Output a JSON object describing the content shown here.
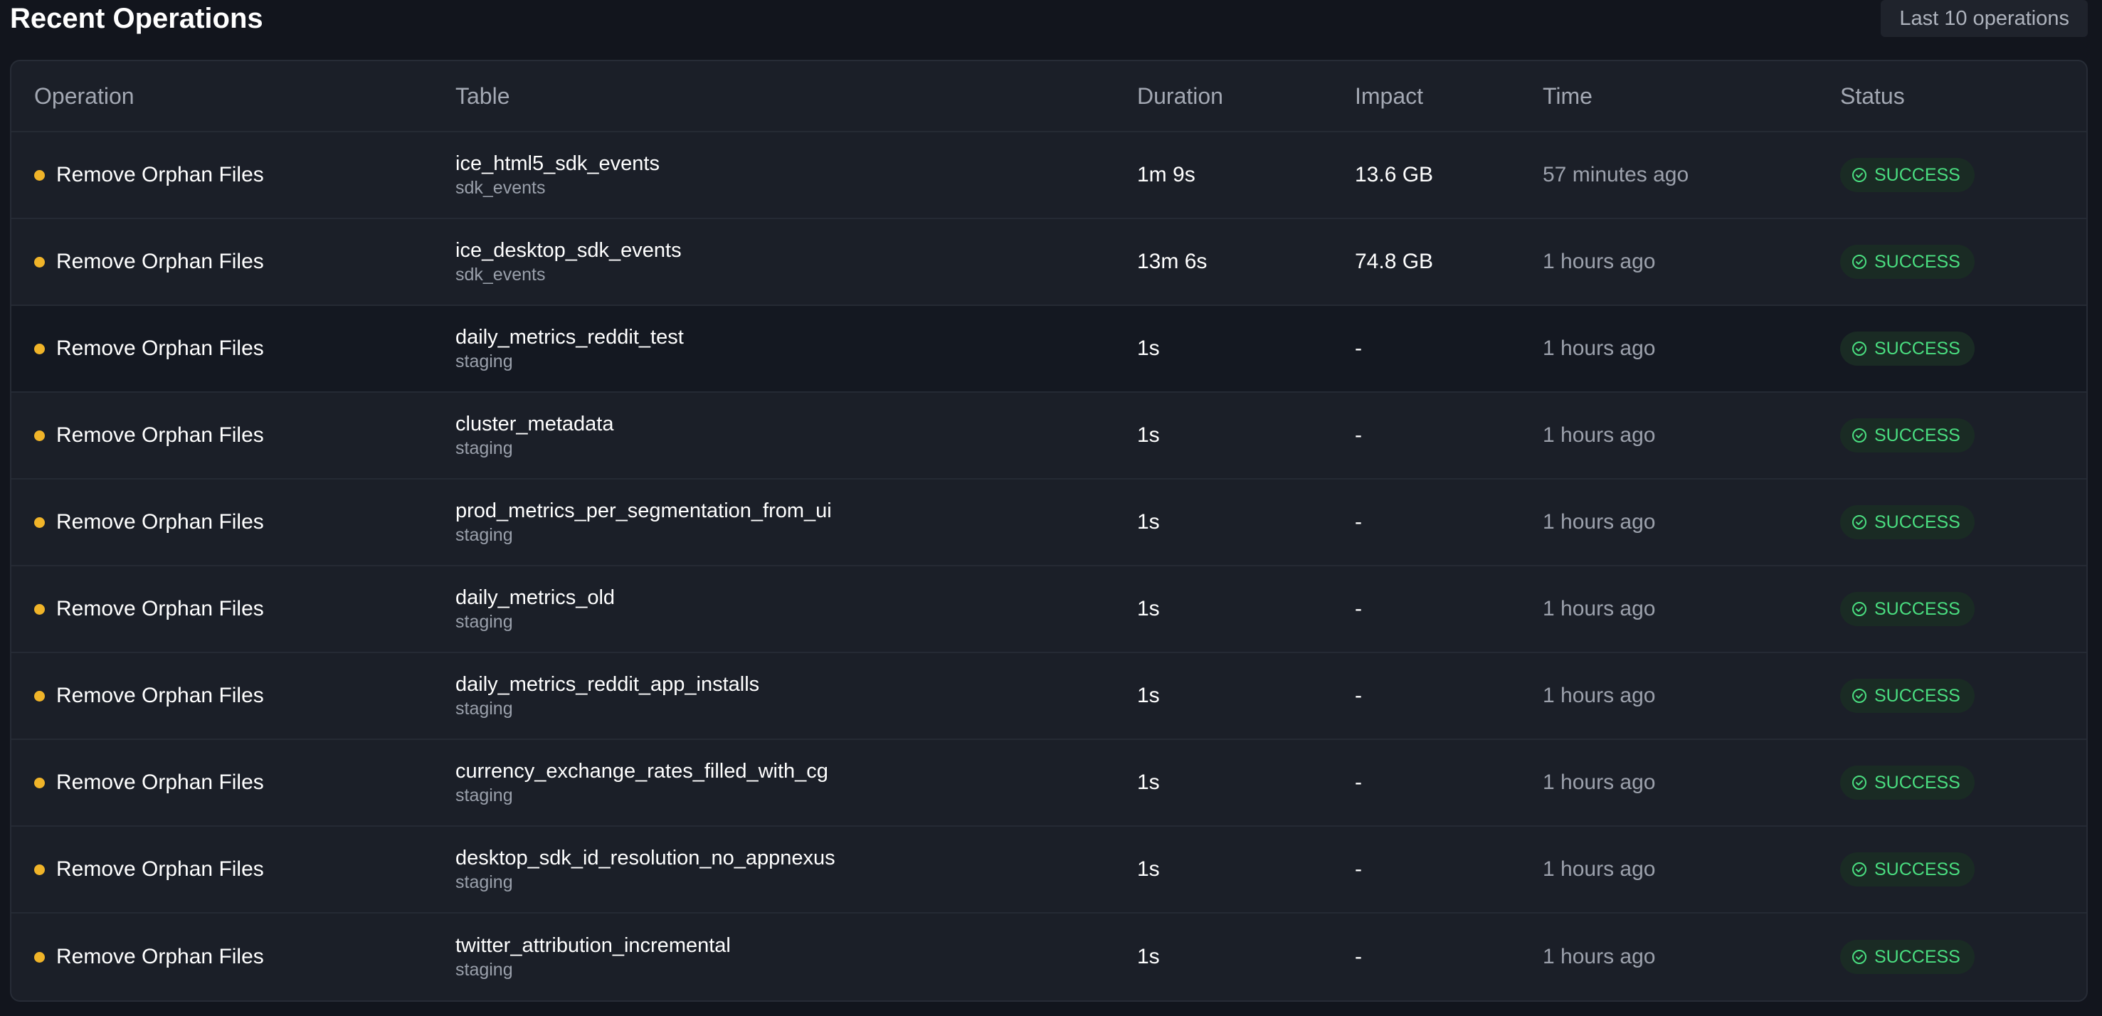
{
  "header": {
    "title": "Recent Operations",
    "count_label": "Last 10 operations"
  },
  "table": {
    "columns": [
      "Operation",
      "Table",
      "Duration",
      "Impact",
      "Time",
      "Status"
    ],
    "rows": [
      {
        "operation": "Remove Orphan Files",
        "table": "ice_html5_sdk_events",
        "schema": "sdk_events",
        "duration": "1m 9s",
        "impact": "13.6 GB",
        "time": "57 minutes ago",
        "status": "SUCCESS"
      },
      {
        "operation": "Remove Orphan Files",
        "table": "ice_desktop_sdk_events",
        "schema": "sdk_events",
        "duration": "13m 6s",
        "impact": "74.8 GB",
        "time": "1 hours ago",
        "status": "SUCCESS"
      },
      {
        "operation": "Remove Orphan Files",
        "table": "daily_metrics_reddit_test",
        "schema": "staging",
        "duration": "1s",
        "impact": "-",
        "time": "1 hours ago",
        "status": "SUCCESS"
      },
      {
        "operation": "Remove Orphan Files",
        "table": "cluster_metadata",
        "schema": "staging",
        "duration": "1s",
        "impact": "-",
        "time": "1 hours ago",
        "status": "SUCCESS"
      },
      {
        "operation": "Remove Orphan Files",
        "table": "prod_metrics_per_segmentation_from_ui",
        "schema": "staging",
        "duration": "1s",
        "impact": "-",
        "time": "1 hours ago",
        "status": "SUCCESS"
      },
      {
        "operation": "Remove Orphan Files",
        "table": "daily_metrics_old",
        "schema": "staging",
        "duration": "1s",
        "impact": "-",
        "time": "1 hours ago",
        "status": "SUCCESS"
      },
      {
        "operation": "Remove Orphan Files",
        "table": "daily_metrics_reddit_app_installs",
        "schema": "staging",
        "duration": "1s",
        "impact": "-",
        "time": "1 hours ago",
        "status": "SUCCESS"
      },
      {
        "operation": "Remove Orphan Files",
        "table": "currency_exchange_rates_filled_with_cg",
        "schema": "staging",
        "duration": "1s",
        "impact": "-",
        "time": "1 hours ago",
        "status": "SUCCESS"
      },
      {
        "operation": "Remove Orphan Files",
        "table": "desktop_sdk_id_resolution_no_appnexus",
        "schema": "staging",
        "duration": "1s",
        "impact": "-",
        "time": "1 hours ago",
        "status": "SUCCESS"
      },
      {
        "operation": "Remove Orphan Files",
        "table": "twitter_attribution_incremental",
        "schema": "staging",
        "duration": "1s",
        "impact": "-",
        "time": "1 hours ago",
        "status": "SUCCESS"
      }
    ]
  },
  "icons": {
    "operation_dot": "status-dot-icon",
    "status": "check-circle-icon"
  },
  "colors": {
    "background": "#12151d",
    "card": "#1b1f28",
    "operation_dot": "#f0b429",
    "success_text": "#4ade80",
    "success_bg": "#1a2b24"
  }
}
